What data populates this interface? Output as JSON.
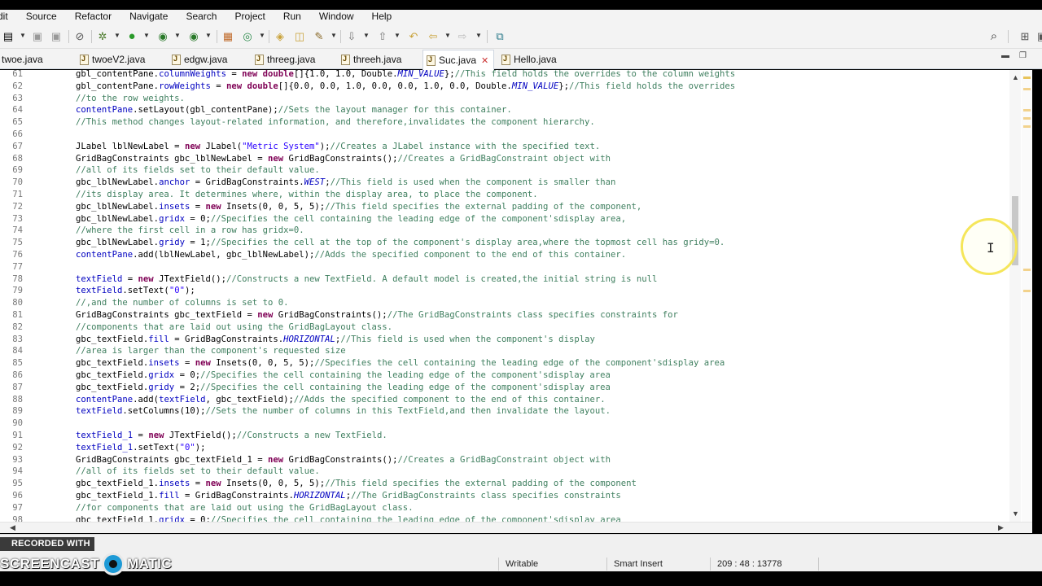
{
  "menu": [
    "dit",
    "Source",
    "Refactor",
    "Navigate",
    "Search",
    "Project",
    "Run",
    "Window",
    "Help"
  ],
  "tabs": [
    {
      "label": "twoe.java",
      "active": false
    },
    {
      "label": "twoeV2.java",
      "active": false
    },
    {
      "label": "edgw.java",
      "active": false
    },
    {
      "label": "threeg.java",
      "active": false
    },
    {
      "label": "threeh.java",
      "active": false
    },
    {
      "label": "Suc.java",
      "active": true
    },
    {
      "label": "Hello.java",
      "active": false
    }
  ],
  "tab_close_glyph": "✕",
  "editor": {
    "lines": [
      {
        "n": "61",
        "segs": [
          [
            "t",
            "gbl_contentPane."
          ],
          [
            "f",
            "columnWeights"
          ],
          [
            "t",
            " = "
          ],
          [
            "k",
            "new"
          ],
          [
            "t",
            " "
          ],
          [
            "k",
            "double"
          ],
          [
            "t",
            "[]{1.0, 1.0, Double."
          ],
          [
            "i",
            "MIN_VALUE"
          ],
          [
            "t",
            "};"
          ],
          [
            "c",
            "//This field holds the overrides to the column weights"
          ]
        ]
      },
      {
        "n": "62",
        "segs": [
          [
            "t",
            "gbl_contentPane."
          ],
          [
            "f",
            "rowWeights"
          ],
          [
            "t",
            " = "
          ],
          [
            "k",
            "new"
          ],
          [
            "t",
            " "
          ],
          [
            "k",
            "double"
          ],
          [
            "t",
            "[]{0.0, 0.0, 1.0, 0.0, 0.0, 1.0, 0.0, Double."
          ],
          [
            "i",
            "MIN_VALUE"
          ],
          [
            "t",
            "};"
          ],
          [
            "c",
            "//This field holds the overrides"
          ]
        ]
      },
      {
        "n": "63",
        "segs": [
          [
            "c",
            "//to the row weights."
          ]
        ]
      },
      {
        "n": "64",
        "segs": [
          [
            "f",
            "contentPane"
          ],
          [
            "t",
            ".setLayout(gbl_contentPane);"
          ],
          [
            "c",
            "//Sets the layout manager for this container."
          ]
        ]
      },
      {
        "n": "65",
        "segs": [
          [
            "c",
            "//This method changes layout-related information, and therefore,invalidates the component hierarchy."
          ]
        ]
      },
      {
        "n": "66",
        "segs": []
      },
      {
        "n": "67",
        "segs": [
          [
            "t",
            "JLabel lblNewLabel = "
          ],
          [
            "k",
            "new"
          ],
          [
            "t",
            " JLabel("
          ],
          [
            "s",
            "\"Metric System\""
          ],
          [
            "t",
            ");"
          ],
          [
            "c",
            "//Creates a JLabel instance with the specified text."
          ]
        ]
      },
      {
        "n": "68",
        "segs": [
          [
            "t",
            "GridBagConstraints gbc_lblNewLabel = "
          ],
          [
            "k",
            "new"
          ],
          [
            "t",
            " GridBagConstraints();"
          ],
          [
            "c",
            "//Creates a GridBagConstraint object with"
          ]
        ]
      },
      {
        "n": "69",
        "segs": [
          [
            "c",
            "//all of its fields set to their default value."
          ]
        ]
      },
      {
        "n": "70",
        "segs": [
          [
            "t",
            "gbc_lblNewLabel."
          ],
          [
            "f",
            "anchor"
          ],
          [
            "t",
            " = GridBagConstraints."
          ],
          [
            "i",
            "WEST"
          ],
          [
            "t",
            ";"
          ],
          [
            "c",
            "//This field is used when the component is smaller than"
          ]
        ]
      },
      {
        "n": "71",
        "segs": [
          [
            "c",
            "//its display area. It determines where, within the display area, to place the component."
          ]
        ]
      },
      {
        "n": "72",
        "segs": [
          [
            "t",
            "gbc_lblNewLabel."
          ],
          [
            "f",
            "insets"
          ],
          [
            "t",
            " = "
          ],
          [
            "k",
            "new"
          ],
          [
            "t",
            " Insets(0, 0, 5, 5);"
          ],
          [
            "c",
            "//This field specifies the external padding of the component,"
          ]
        ]
      },
      {
        "n": "73",
        "segs": [
          [
            "t",
            "gbc_lblNewLabel."
          ],
          [
            "f",
            "gridx"
          ],
          [
            "t",
            " = 0;"
          ],
          [
            "c",
            "//Specifies the cell containing the leading edge of the component'sdisplay area,"
          ]
        ]
      },
      {
        "n": "74",
        "segs": [
          [
            "c",
            "//where the first cell in a row has gridx=0."
          ]
        ]
      },
      {
        "n": "75",
        "segs": [
          [
            "t",
            "gbc_lblNewLabel."
          ],
          [
            "f",
            "gridy"
          ],
          [
            "t",
            " = 1;"
          ],
          [
            "c",
            "//Specifies the cell at the top of the component's display area,where the topmost cell has gridy=0."
          ]
        ]
      },
      {
        "n": "76",
        "segs": [
          [
            "f",
            "contentPane"
          ],
          [
            "t",
            ".add(lblNewLabel, gbc_lblNewLabel);"
          ],
          [
            "c",
            "//Adds the specified component to the end of this container."
          ]
        ]
      },
      {
        "n": "77",
        "segs": []
      },
      {
        "n": "78",
        "segs": [
          [
            "f",
            "textField"
          ],
          [
            "t",
            " = "
          ],
          [
            "k",
            "new"
          ],
          [
            "t",
            " JTextField();"
          ],
          [
            "c",
            "//Constructs a new TextField. A default model is created,the initial string is null"
          ]
        ]
      },
      {
        "n": "79",
        "segs": [
          [
            "f",
            "textField"
          ],
          [
            "t",
            ".setText("
          ],
          [
            "s",
            "\"0\""
          ],
          [
            "t",
            ");"
          ]
        ]
      },
      {
        "n": "80",
        "segs": [
          [
            "c",
            "//,and the number of columns is set to 0."
          ]
        ]
      },
      {
        "n": "81",
        "segs": [
          [
            "t",
            "GridBagConstraints gbc_textField = "
          ],
          [
            "k",
            "new"
          ],
          [
            "t",
            " GridBagConstraints();"
          ],
          [
            "c",
            "//The GridBagConstraints class specifies constraints for"
          ]
        ]
      },
      {
        "n": "82",
        "segs": [
          [
            "c",
            "//components that are laid out using the GridBagLayout class."
          ]
        ]
      },
      {
        "n": "83",
        "segs": [
          [
            "t",
            "gbc_textField."
          ],
          [
            "f",
            "fill"
          ],
          [
            "t",
            " = GridBagConstraints."
          ],
          [
            "i",
            "HORIZONTAL"
          ],
          [
            "t",
            ";"
          ],
          [
            "c",
            "//This field is used when the component's display"
          ]
        ]
      },
      {
        "n": "84",
        "segs": [
          [
            "c",
            "//area is larger than the component's requested size"
          ]
        ]
      },
      {
        "n": "85",
        "segs": [
          [
            "t",
            "gbc_textField."
          ],
          [
            "f",
            "insets"
          ],
          [
            "t",
            " = "
          ],
          [
            "k",
            "new"
          ],
          [
            "t",
            " Insets(0, 0, 5, 5);"
          ],
          [
            "c",
            "//Specifies the cell containing the leading edge of the component'sdisplay area"
          ]
        ]
      },
      {
        "n": "86",
        "segs": [
          [
            "t",
            "gbc_textField."
          ],
          [
            "f",
            "gridx"
          ],
          [
            "t",
            " = 0;"
          ],
          [
            "c",
            "//Specifies the cell containing the leading edge of the component'sdisplay area"
          ]
        ]
      },
      {
        "n": "87",
        "segs": [
          [
            "t",
            "gbc_textField."
          ],
          [
            "f",
            "gridy"
          ],
          [
            "t",
            " = 2;"
          ],
          [
            "c",
            "//Specifies the cell containing the leading edge of the component'sdisplay area"
          ]
        ]
      },
      {
        "n": "88",
        "segs": [
          [
            "f",
            "contentPane"
          ],
          [
            "t",
            ".add("
          ],
          [
            "f",
            "textField"
          ],
          [
            "t",
            ", gbc_textField);"
          ],
          [
            "c",
            "//Adds the specified component to the end of this container."
          ]
        ]
      },
      {
        "n": "89",
        "segs": [
          [
            "f",
            "textField"
          ],
          [
            "t",
            ".setColumns(10);"
          ],
          [
            "c",
            "//Sets the number of columns in this TextField,and then invalidate the layout."
          ]
        ]
      },
      {
        "n": "90",
        "segs": []
      },
      {
        "n": "91",
        "segs": [
          [
            "f",
            "textField_1"
          ],
          [
            "t",
            " = "
          ],
          [
            "k",
            "new"
          ],
          [
            "t",
            " JTextField();"
          ],
          [
            "c",
            "//Constructs a new TextField."
          ]
        ]
      },
      {
        "n": "92",
        "segs": [
          [
            "f",
            "textField_1"
          ],
          [
            "t",
            ".setText("
          ],
          [
            "s",
            "\"0\""
          ],
          [
            "t",
            ");"
          ]
        ]
      },
      {
        "n": "93",
        "segs": [
          [
            "t",
            "GridBagConstraints gbc_textField_1 = "
          ],
          [
            "k",
            "new"
          ],
          [
            "t",
            " GridBagConstraints();"
          ],
          [
            "c",
            "//Creates a GridBagConstraint object with"
          ]
        ]
      },
      {
        "n": "94",
        "segs": [
          [
            "c",
            "//all of its fields set to their default value."
          ]
        ]
      },
      {
        "n": "95",
        "segs": [
          [
            "t",
            "gbc_textField_1."
          ],
          [
            "f",
            "insets"
          ],
          [
            "t",
            " = "
          ],
          [
            "k",
            "new"
          ],
          [
            "t",
            " Insets(0, 0, 5, 5);"
          ],
          [
            "c",
            "//This field specifies the external padding of the component"
          ]
        ]
      },
      {
        "n": "96",
        "segs": [
          [
            "t",
            "gbc_textField_1."
          ],
          [
            "f",
            "fill"
          ],
          [
            "t",
            " = GridBagConstraints."
          ],
          [
            "i",
            "HORIZONTAL"
          ],
          [
            "t",
            ";"
          ],
          [
            "c",
            "//The GridBagConstraints class specifies constraints"
          ]
        ]
      },
      {
        "n": "97",
        "segs": [
          [
            "c",
            "//for components that are laid out using the GridBagLayout class."
          ]
        ]
      },
      {
        "n": "98",
        "segs": [
          [
            "t",
            "gbc_textField_1."
          ],
          [
            "f",
            "gridx"
          ],
          [
            "t",
            " = 0;"
          ],
          [
            "c",
            "//Specifies the cell containing the leading edge of the component'sdisplay area"
          ]
        ]
      }
    ]
  },
  "status": {
    "writable": "Writable",
    "insert_mode": "Smart Insert",
    "position": "209 : 48 : 13778"
  },
  "watermark": {
    "recorded": "RECORDED WITH",
    "brand_left": "SCREENCAST",
    "brand_right": "MATIC"
  },
  "colors": {
    "keyword": "#7f0055",
    "field": "#0000c0",
    "comment": "#3f7f5f",
    "string": "#2a00ff",
    "cursor_ring": "#f5e65a"
  }
}
